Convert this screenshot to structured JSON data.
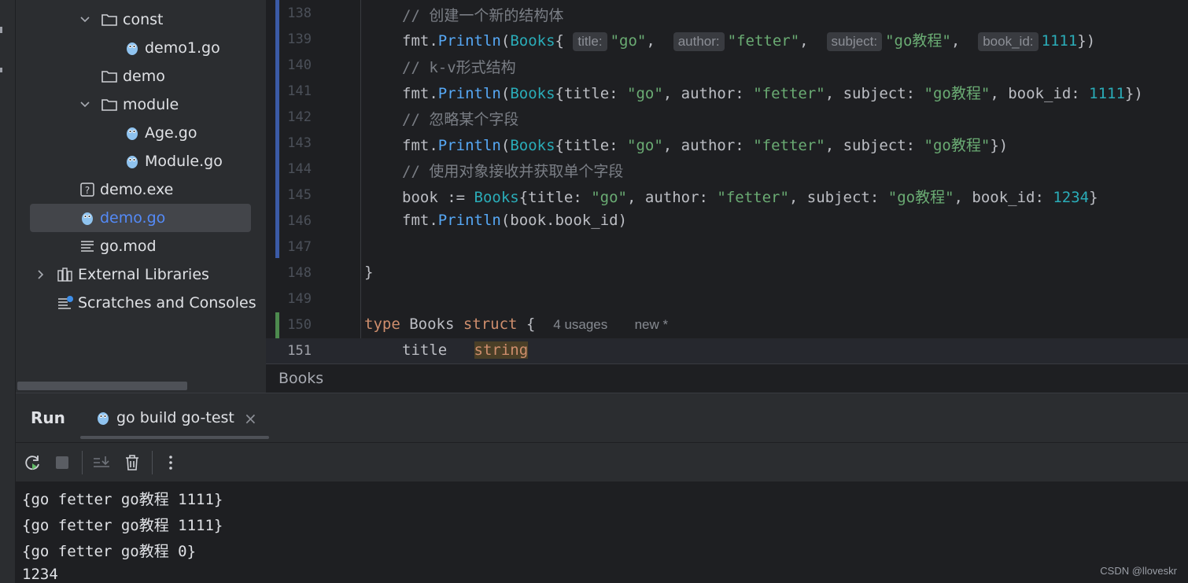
{
  "project_tree": {
    "items": [
      {
        "label": "const",
        "kind": "folder",
        "expanded": true
      },
      {
        "label": "demo1.go",
        "kind": "go-file"
      },
      {
        "label": "demo",
        "kind": "folder"
      },
      {
        "label": "module",
        "kind": "folder",
        "expanded": true
      },
      {
        "label": "Age.go",
        "kind": "go-file"
      },
      {
        "label": "Module.go",
        "kind": "go-file"
      },
      {
        "label": "demo.exe",
        "kind": "unknown-file"
      },
      {
        "label": "demo.go",
        "kind": "go-file",
        "selected": true
      },
      {
        "label": "go.mod",
        "kind": "text-file"
      },
      {
        "label": "External Libraries",
        "kind": "library",
        "collapsed": true
      },
      {
        "label": "Scratches and Consoles",
        "kind": "scratches"
      }
    ]
  },
  "editor": {
    "current_line": 151,
    "lines": [
      {
        "num": "138",
        "comment": "// 创建一个新的结构体"
      },
      {
        "num": "139",
        "fmt": "fmt",
        "dot": ".",
        "fn": "Println",
        "open": "(",
        "type": "Books",
        "brace": "{",
        "hints": [
          {
            "label": "title:",
            "value": "\"go\"",
            "sep": ", "
          },
          {
            "label": "author:",
            "value": "\"fetter\"",
            "sep": ", "
          },
          {
            "label": "subject:",
            "value": "\"go教程\"",
            "sep": ", "
          },
          {
            "label": "book_id:",
            "num": "1111",
            "sep": ""
          }
        ],
        "close": "})"
      },
      {
        "num": "140",
        "comment": "// k-v形式结构"
      },
      {
        "num": "141",
        "fmt": "fmt",
        "dot": ".",
        "fn": "Println",
        "open": "(",
        "type": "Books",
        "pre": "{title: ",
        "s1": "\"go\"",
        "m1": ", author: ",
        "s2": "\"fetter\"",
        "m2": ", subject: ",
        "s3": "\"go教程\"",
        "m3": ", book_id: ",
        "n1": "1111",
        "close": "})"
      },
      {
        "num": "142",
        "comment": "// 忽略某个字段"
      },
      {
        "num": "143",
        "fmt": "fmt",
        "dot": ".",
        "fn": "Println",
        "open": "(",
        "type": "Books",
        "pre": "{title: ",
        "s1": "\"go\"",
        "m1": ", author: ",
        "s2": "\"fetter\"",
        "m2": ", subject: ",
        "s3": "\"go教程\"",
        "close": "})"
      },
      {
        "num": "144",
        "comment": "// 使用对象接收并获取单个字段"
      },
      {
        "num": "145",
        "lhs": "book := ",
        "type": "Books",
        "pre": "{title: ",
        "s1": "\"go\"",
        "m1": ", author: ",
        "s2": "\"fetter\"",
        "m2": ", subject: ",
        "s3": "\"go教程\"",
        "m3": ", book_id: ",
        "n1": "1234",
        "close": "}"
      },
      {
        "num": "146",
        "fmt": "fmt",
        "dot": ".",
        "fn": "Println",
        "rest": "(book.book_id)"
      },
      {
        "num": "147"
      },
      {
        "num": "148",
        "text": "}"
      },
      {
        "num": "149"
      },
      {
        "num": "150",
        "kw1": "type",
        "name": " Books ",
        "kw2": "struct",
        "brace": " {",
        "usages": "4 usages",
        "new": "new *"
      },
      {
        "num": "151",
        "field": "title",
        "ftype": "string"
      }
    ]
  },
  "breadcrumb": {
    "label": "Books"
  },
  "run_panel": {
    "title": "Run",
    "tab_label": "go build go-test",
    "tab_close": "×",
    "output": [
      "{go fetter go教程 1111}",
      "{go fetter go教程 1111}",
      "{go fetter go教程 0}",
      "1234"
    ]
  },
  "watermark": "CSDN @lloveskr",
  "colors": {
    "keyword": "#cf8e6d",
    "function": "#56a8f5",
    "type": "#2aacb8",
    "string": "#6aab73",
    "number": "#2aacb8",
    "comment": "#7a7e85",
    "selection_text": "#548af7"
  }
}
